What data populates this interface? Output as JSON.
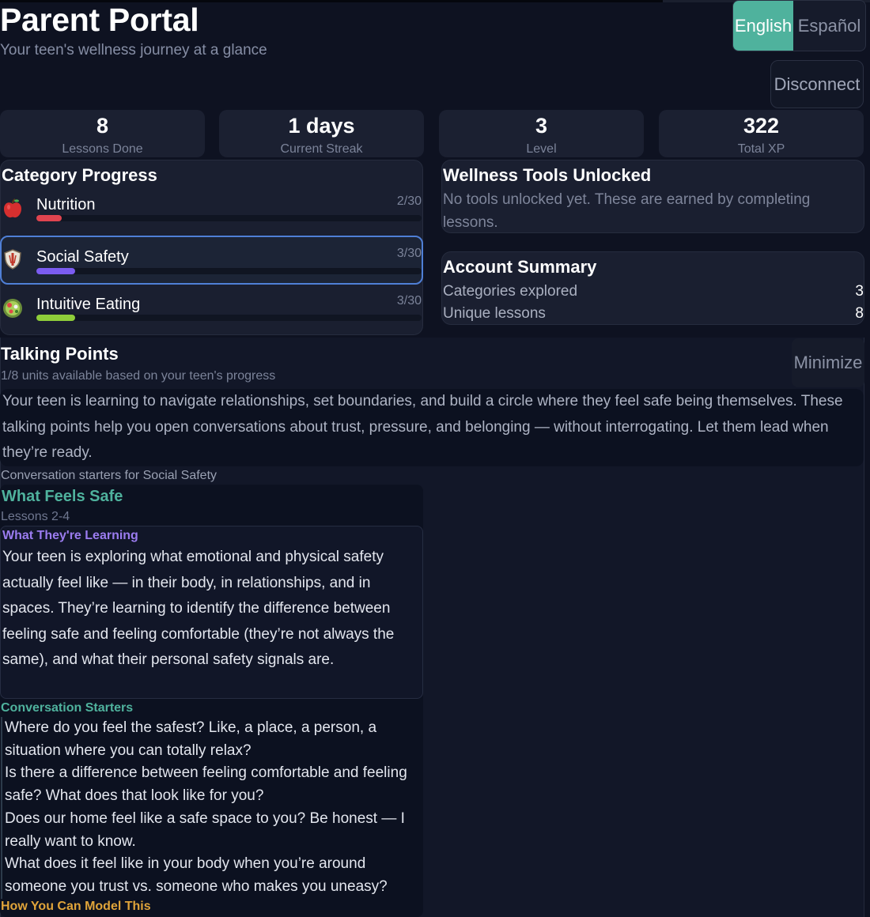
{
  "header": {
    "title": "Parent Portal",
    "subtitle": "Your teen's wellness journey at a glance"
  },
  "language": {
    "options": [
      "English",
      "Español"
    ],
    "selected": "English"
  },
  "disconnect_label": "Disconnect",
  "stats": [
    {
      "value": "8",
      "label": "Lessons Done"
    },
    {
      "value": "1 days",
      "label": "Current Streak"
    },
    {
      "value": "3",
      "label": "Level"
    },
    {
      "value": "322",
      "label": "Total XP"
    }
  ],
  "category_progress": {
    "title": "Category Progress",
    "items": [
      {
        "name": "Nutrition",
        "count": "2/30",
        "progress": 0.0667,
        "color": "#e0444f",
        "icon": "apple-icon",
        "active": false
      },
      {
        "name": "Social Safety",
        "count": "3/30",
        "progress": 0.1,
        "color": "#7b5cf0",
        "icon": "shield-icon",
        "active": true
      },
      {
        "name": "Intuitive Eating",
        "count": "3/30",
        "progress": 0.1,
        "color": "#8fce3a",
        "icon": "salad-icon",
        "active": false
      }
    ]
  },
  "wellness_tools": {
    "title": "Wellness Tools Unlocked",
    "empty_text": "No tools unlocked yet. These are earned by completing lessons."
  },
  "account_summary": {
    "title": "Account Summary",
    "rows": [
      {
        "label": "Categories explored",
        "value": "3"
      },
      {
        "label": "Unique lessons",
        "value": "8"
      }
    ]
  },
  "talking_points": {
    "title": "Talking Points",
    "minimize_label": "Minimize",
    "availability": "1/8 units available based on your teen's progress",
    "intro": "Your teen is learning to navigate relationships, set boundaries, and build a circle where they feel safe being themselves. These talking points help you open conversations about trust, pressure, and belonging — without interrogating. Let them lead when they’re ready.",
    "starters_for": "Conversation starters for Social Safety",
    "unit": {
      "title": "What Feels Safe",
      "lessons": "Lessons 2-4",
      "learning_heading": "What They're Learning",
      "learning_text": "Your teen is exploring what emotional and physical safety actually feel like — in their body, in relationships, and in spaces. They’re learning to identify the difference between feeling safe and feeling comfortable (they’re not always the same), and what their personal safety signals are.",
      "starters_heading": "Conversation Starters",
      "starters": [
        "Where do you feel the safest? Like, a place, a person, a situation where you can totally relax?",
        "Is there a difference between feeling comfortable and feeling safe? What does that look like for you?",
        "Does our home feel like a safe space to you? Be honest — I really want to know.",
        "What does it feel like in your body when you’re around someone you trust vs. someone who makes you uneasy?"
      ],
      "model_heading": "How You Can Model This"
    }
  }
}
